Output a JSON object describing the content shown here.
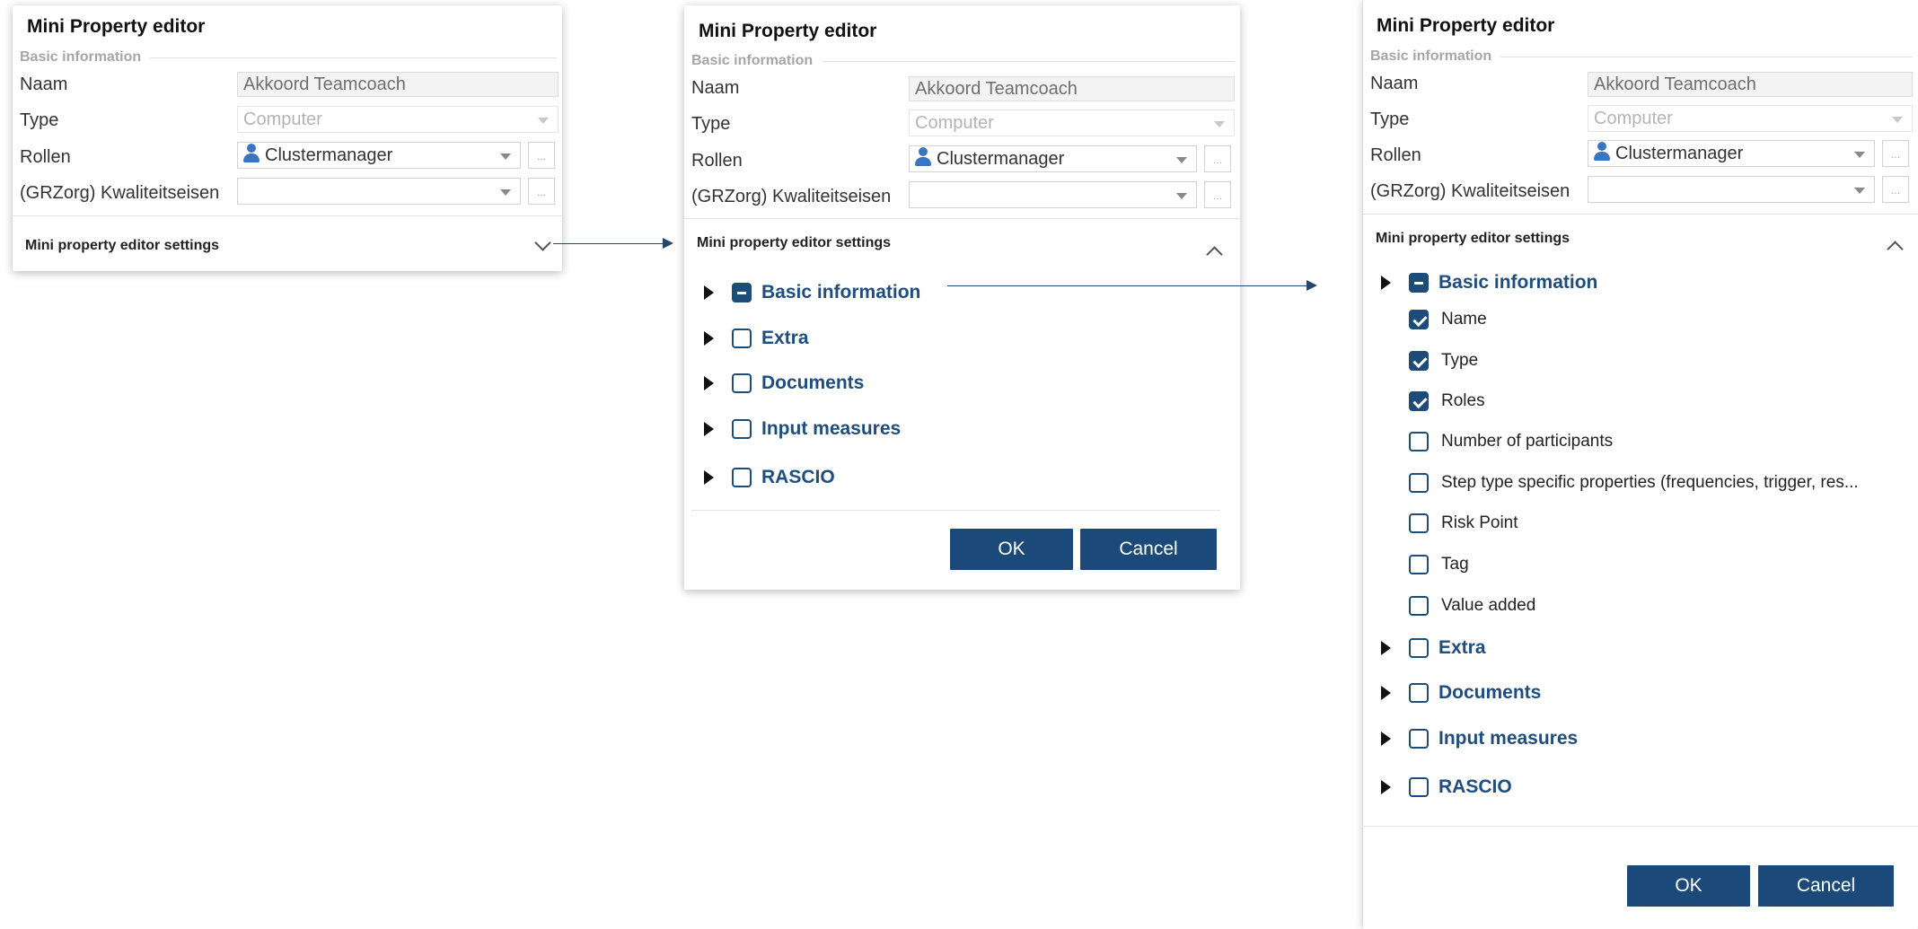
{
  "editor": {
    "title": "Mini Property editor",
    "section_basic": "Basic information",
    "fields": {
      "naam_label": "Naam",
      "naam_value": "Akkoord Teamcoach",
      "type_label": "Type",
      "type_value": "Computer",
      "rollen_label": "Rollen",
      "rollen_value": "Clustermanager",
      "kwaliteit_label": "(GRZorg) Kwaliteitseisen",
      "kwaliteit_value": "",
      "browse_button": "..."
    },
    "settings_title": "Mini property editor settings"
  },
  "tree": {
    "categories": [
      {
        "label": "Basic information",
        "state": "partial"
      },
      {
        "label": "Extra",
        "state": "unchecked"
      },
      {
        "label": "Documents",
        "state": "unchecked"
      },
      {
        "label": "Input measures",
        "state": "unchecked"
      },
      {
        "label": "RASCIO",
        "state": "unchecked"
      }
    ],
    "basic_items": [
      {
        "label": "Name",
        "checked": true
      },
      {
        "label": "Type",
        "checked": true
      },
      {
        "label": "Roles",
        "checked": true
      },
      {
        "label": "Number of participants",
        "checked": false
      },
      {
        "label": "Step type specific properties (frequencies, trigger, res...",
        "checked": false
      },
      {
        "label": "Risk Point",
        "checked": false
      },
      {
        "label": "Tag",
        "checked": false
      },
      {
        "label": "Value added",
        "checked": false
      }
    ]
  },
  "buttons": {
    "ok": "OK",
    "cancel": "Cancel"
  },
  "colors": {
    "accent": "#1b4a7a",
    "category_text": "#1e4e80",
    "checkbox": "#1d4b7a",
    "arrow": "#25476b"
  }
}
